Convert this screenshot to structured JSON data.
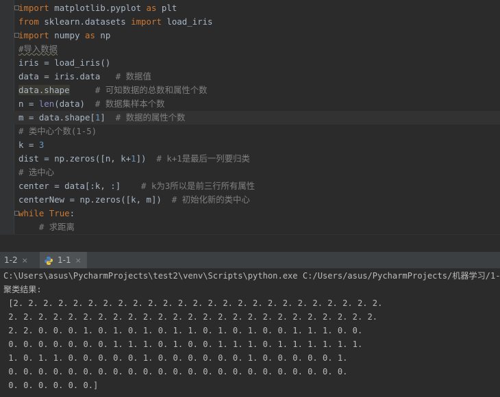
{
  "editor": {
    "lines": [
      {
        "segments": [
          [
            "kw",
            "import"
          ],
          [
            "",
            "matplotlib.pyplot"
          ],
          [
            "kw",
            "as"
          ],
          [
            "",
            "plt"
          ]
        ]
      },
      {
        "segments": [
          [
            "kw",
            "from"
          ],
          [
            "",
            "sklearn.datasets"
          ],
          [
            "kw",
            "import"
          ],
          [
            "",
            "load_iris"
          ]
        ]
      },
      {
        "segments": [
          [
            "kw",
            "import"
          ],
          [
            "",
            "numpy"
          ],
          [
            "kw",
            "as"
          ],
          [
            "",
            "np"
          ]
        ]
      },
      {
        "segments": [
          [
            "cm-wavy",
            "#导入数据"
          ]
        ]
      },
      {
        "segments": [
          [
            "",
            "iris = load_iris()"
          ]
        ]
      },
      {
        "segments": [
          [
            "",
            "data = iris.data"
          ],
          [
            "cm",
            "# 数据值"
          ]
        ]
      },
      {
        "segments": [
          [
            "hl",
            "data.shape"
          ],
          [
            "cm",
            "# 可知数据的总数和属性个数"
          ]
        ]
      },
      {
        "segments": [
          [
            "",
            "n = "
          ],
          [
            "bi",
            "len"
          ],
          [
            "",
            "(data)"
          ],
          [
            "cm",
            "# 数据集样本个数"
          ]
        ]
      },
      {
        "segments": [
          [
            "",
            "m = data.shape["
          ],
          [
            "num",
            "1"
          ],
          [
            "",
            "]"
          ],
          [
            "cm",
            "# 数据的属性个数"
          ]
        ]
      },
      {
        "segments": [
          [
            "cm",
            "# 类中心个数(1-5)"
          ]
        ]
      },
      {
        "segments": [
          [
            "",
            "k = "
          ],
          [
            "num",
            "3"
          ]
        ]
      },
      {
        "segments": [
          [
            "",
            "dist = np.zeros([n, k+"
          ],
          [
            "num",
            "1"
          ],
          [
            "",
            "])"
          ],
          [
            "cm",
            "# k+1是最后一列要归类"
          ]
        ]
      },
      {
        "segments": [
          [
            "cm",
            "# 选中心"
          ]
        ]
      },
      {
        "segments": [
          [
            "",
            "center = data[:k, :]"
          ],
          [
            "cm",
            "# k为3所以是前三行所有属性"
          ]
        ]
      },
      {
        "segments": [
          [
            "",
            "centerNew = np.zeros([k, m])"
          ],
          [
            "cm",
            "# 初始化新的类中心"
          ]
        ]
      },
      {
        "segments": [
          [
            "kw",
            "while"
          ],
          [
            "kw",
            "True"
          ],
          [
            "",
            ":"
          ]
        ]
      },
      {
        "segments": [
          [
            "cm",
            "# 求距离"
          ]
        ]
      }
    ]
  },
  "tabs": [
    {
      "label": "1-2",
      "close": "×"
    },
    {
      "label": "1-1",
      "close": "×"
    }
  ],
  "console": {
    "lines": [
      "C:\\Users\\asus\\PycharmProjects\\test2\\venv\\Scripts\\python.exe C:/Users/asus/PycharmProjects/机器学习/1-1.py",
      "聚类结果:",
      " [2. 2. 2. 2. 2. 2. 2. 2. 2. 2. 2. 2. 2. 2. 2. 2. 2. 2. 2. 2. 2. 2. 2. 2. 2.",
      " 2. 2. 2. 2. 2. 2. 2. 2. 2. 2. 2. 2. 2. 2. 2. 2. 2. 2. 2. 2. 2. 2. 2. 2. 2.",
      " 2. 2. 0. 0. 0. 1. 0. 1. 0. 1. 0. 1. 1. 0. 1. 0. 1. 0. 0. 1. 1. 1. 0. 0.",
      " 0. 0. 0. 0. 0. 0. 0. 1. 1. 1. 0. 1. 0. 0. 1. 1. 1. 0. 1. 1. 1. 1. 1. 1.",
      " 1. 0. 1. 1. 0. 0. 0. 0. 0. 1. 0. 0. 0. 0. 0. 0. 1. 0. 0. 0. 0. 0. 1.",
      " 0. 0. 0. 0. 0. 0. 0. 0. 0. 0. 0. 0. 0. 0. 0. 0. 0. 0. 0. 0. 0. 0. 0.",
      " 0. 0. 0. 0. 0. 0.]"
    ]
  }
}
